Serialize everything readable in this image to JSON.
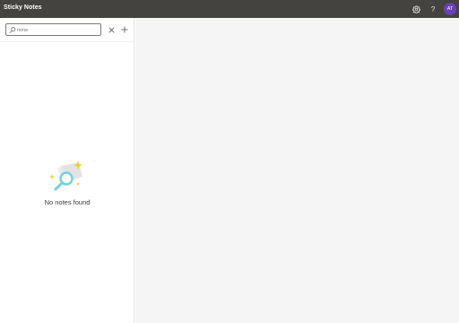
{
  "app": {
    "title": "Sticky Notes"
  },
  "titlebar": {
    "settings_icon": "gear-icon",
    "help_label": "?",
    "avatar_initials": "AT",
    "avatar_color": "#6b3fb5"
  },
  "notes_panel": {
    "search": {
      "value": "",
      "placeholder": "none"
    },
    "clear_icon": "close-icon",
    "add_icon": "plus-icon",
    "empty_state": {
      "icon": "magnifier-notes-icon",
      "message": "No notes found"
    }
  },
  "colors": {
    "titlebar_bg": "#454340",
    "panel_bg": "#ffffff",
    "pane_bg": "#f5f5f5",
    "sparkle": "#f2cf1f",
    "magnifier": "#6fd3d6"
  }
}
